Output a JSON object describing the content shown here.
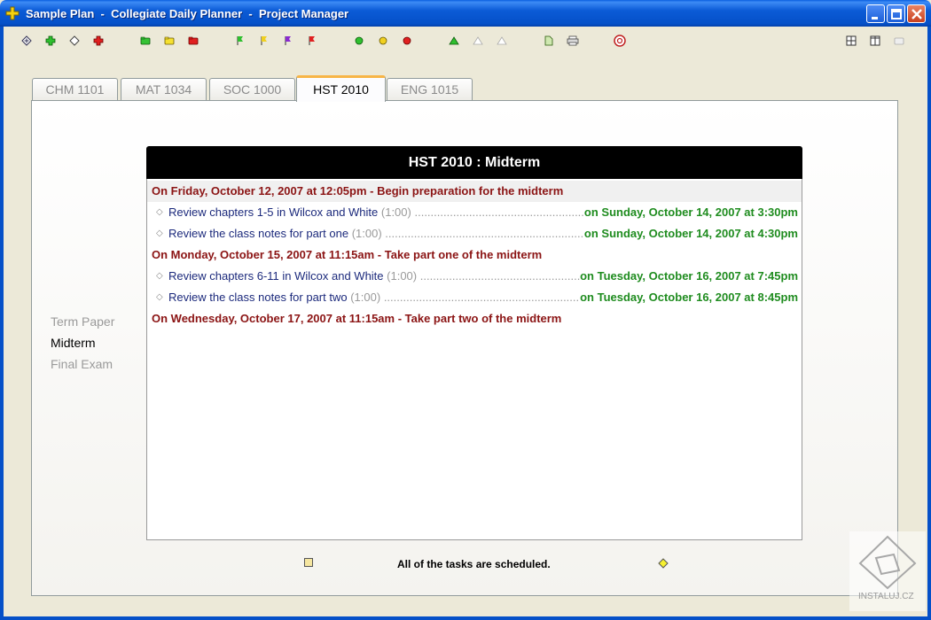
{
  "window": {
    "title": "Sample Plan  -  Collegiate Daily Planner  -  Project Manager"
  },
  "toolbar": {
    "left_icons": [
      "add-item-icon",
      "add-green-icon",
      "add-outline-icon",
      "delete-red-icon",
      "folder-green-icon",
      "folder-yellow-icon",
      "folder-red-icon",
      "flag-green-icon",
      "flag-yellow-icon",
      "flag-purple-icon",
      "flag-red-icon",
      "circle-green-icon",
      "circle-yellow-icon",
      "circle-red-icon",
      "triangle-up-icon",
      "triangle-outline-icon",
      "triangle-outline-icon",
      "document-icon",
      "printer-icon",
      "help-lifebuoy-icon"
    ],
    "right_icons": [
      "grid-view-icon",
      "column-view-icon",
      "folder-open-icon"
    ]
  },
  "tabs": [
    {
      "label": "CHM 1101",
      "active": false
    },
    {
      "label": "MAT 1034",
      "active": false
    },
    {
      "label": "SOC 1000",
      "active": false
    },
    {
      "label": "HST 2010",
      "active": true
    },
    {
      "label": "ENG 1015",
      "active": false
    }
  ],
  "sidenav": [
    {
      "label": "Term Paper",
      "active": false
    },
    {
      "label": "Midterm",
      "active": true
    },
    {
      "label": "Final Exam",
      "active": false
    }
  ],
  "plan": {
    "header": "HST 2010 : Midterm",
    "milestones": [
      {
        "text": "On Friday, October 12, 2007 at 12:05pm - Begin preparation for the midterm"
      },
      {
        "text": "On Monday, October 15, 2007 at 11:15am - Take part one of the midterm"
      },
      {
        "text": "On Wednesday, October 17, 2007 at 11:15am - Take part two of the midterm"
      }
    ],
    "tasks": [
      {
        "name": "Review chapters 1-5 in Wilcox and White",
        "duration": "(1:00)",
        "date": "on Sunday, October 14, 2007 at 3:30pm"
      },
      {
        "name": "Review the class notes for part one",
        "duration": "(1:00)",
        "date": "on Sunday, October 14, 2007 at 4:30pm"
      },
      {
        "name": "Review chapters 6-11 in Wilcox and White",
        "duration": "(1:00)",
        "date": "on Tuesday, October 16, 2007 at 7:45pm"
      },
      {
        "name": "Review the class notes for part two",
        "duration": "(1:00)",
        "date": "on Tuesday, October 16, 2007 at 8:45pm"
      }
    ]
  },
  "status": {
    "message": "All of the tasks are scheduled."
  },
  "watermark": {
    "text": "INSTALUJ.CZ"
  },
  "colors": {
    "milestone": "#8b1414",
    "task_name": "#1c2a7c",
    "task_date": "#1f8c1f",
    "active_tab_accent": "#f7b547"
  }
}
